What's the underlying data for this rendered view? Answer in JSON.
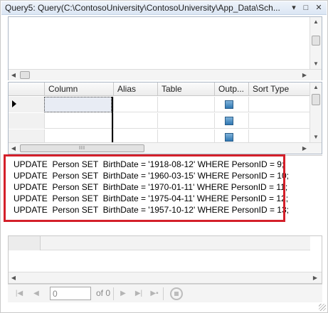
{
  "window": {
    "title": "Query5: Query(C:\\ContosoUniversity\\ContosoUniversity\\App_Data\\Sch...",
    "dropdown_glyph": "▾",
    "maximize_glyph": "□",
    "close_glyph": "✕"
  },
  "criteria_grid": {
    "columns": [
      "Column",
      "Alias",
      "Table",
      "Outp...",
      "Sort Type"
    ],
    "rows": [
      {
        "output_checked": true
      },
      {
        "output_checked": true
      },
      {
        "output_checked": true
      }
    ]
  },
  "sql": {
    "lines": [
      "UPDATE  Person SET  BirthDate = '1918-08-12' WHERE PersonID = 9;",
      "UPDATE  Person SET  BirthDate = '1960-03-15' WHERE PersonID = 10;",
      "UPDATE  Person SET  BirthDate = '1970-01-11' WHERE PersonID = 11;",
      "UPDATE  Person SET  BirthDate = '1975-04-11' WHERE PersonID = 12;",
      "UPDATE  Person SET  BirthDate = '1957-10-12' WHERE PersonID = 13;"
    ],
    "highlight_color": "#d4202a"
  },
  "navigator": {
    "current_record": "0",
    "of_label": "of 0",
    "icons": [
      "first-record-icon",
      "previous-record-icon",
      "next-record-icon",
      "last-record-icon",
      "new-record-icon",
      "stop-icon"
    ]
  },
  "scroll_grip": "III"
}
